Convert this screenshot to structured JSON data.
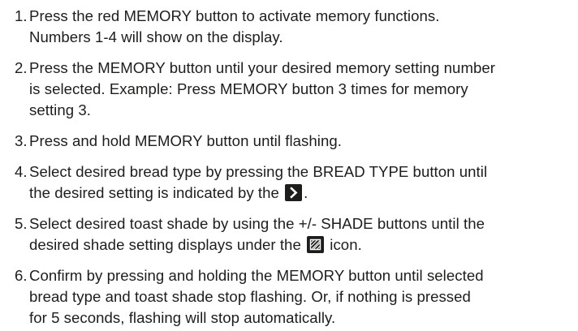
{
  "steps": [
    {
      "number": "1.",
      "lines": [
        "Press the red MEMORY button to activate memory functions.",
        "Numbers 1-4 will show on the display."
      ]
    },
    {
      "number": "2.",
      "lines": [
        "Press the MEMORY button until your desired memory setting number",
        "is selected. Example: Press MEMORY button 3 times for memory",
        "setting 3."
      ]
    },
    {
      "number": "3.",
      "lines": [
        "Press and hold MEMORY button until flashing."
      ]
    },
    {
      "number": "4.",
      "line1": "Select desired bread type by pressing the BREAD TYPE button until",
      "line2_before": "the desired setting is indicated by the",
      "line2_after": ".",
      "icon": "chevron-right-icon"
    },
    {
      "number": "5.",
      "line1": "Select desired toast shade by using the +/- SHADE buttons until the",
      "line2_before": "desired shade setting displays under the",
      "line2_after": "icon.",
      "icon": "toast-shade-icon"
    },
    {
      "number": "6.",
      "lines": [
        "Confirm by pressing and holding the MEMORY button until selected",
        "bread type and toast shade stop flashing. Or, if nothing is pressed",
        "for 5 seconds, flashing will stop automatically."
      ]
    }
  ]
}
